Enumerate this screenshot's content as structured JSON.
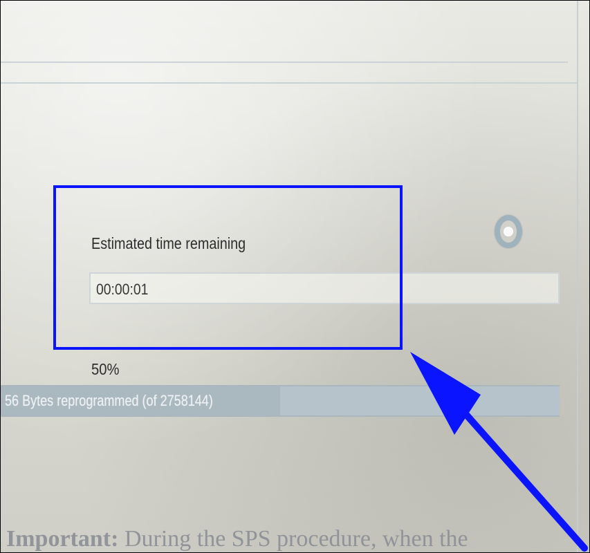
{
  "eta": {
    "label": "Estimated time remaining",
    "value": "00:00:01"
  },
  "progress": {
    "percent_text": "50%",
    "bytes_text": "56 Bytes reprogrammed (of 2758144)",
    "fraction": 0.5
  },
  "caption": {
    "bold": "Important:",
    "text": " During the SPS procedure, when the"
  },
  "colors": {
    "highlight_box": "#0b14ff",
    "arrow": "#0b14ff"
  },
  "icons": {
    "spinner": "busy-indicator-icon"
  }
}
